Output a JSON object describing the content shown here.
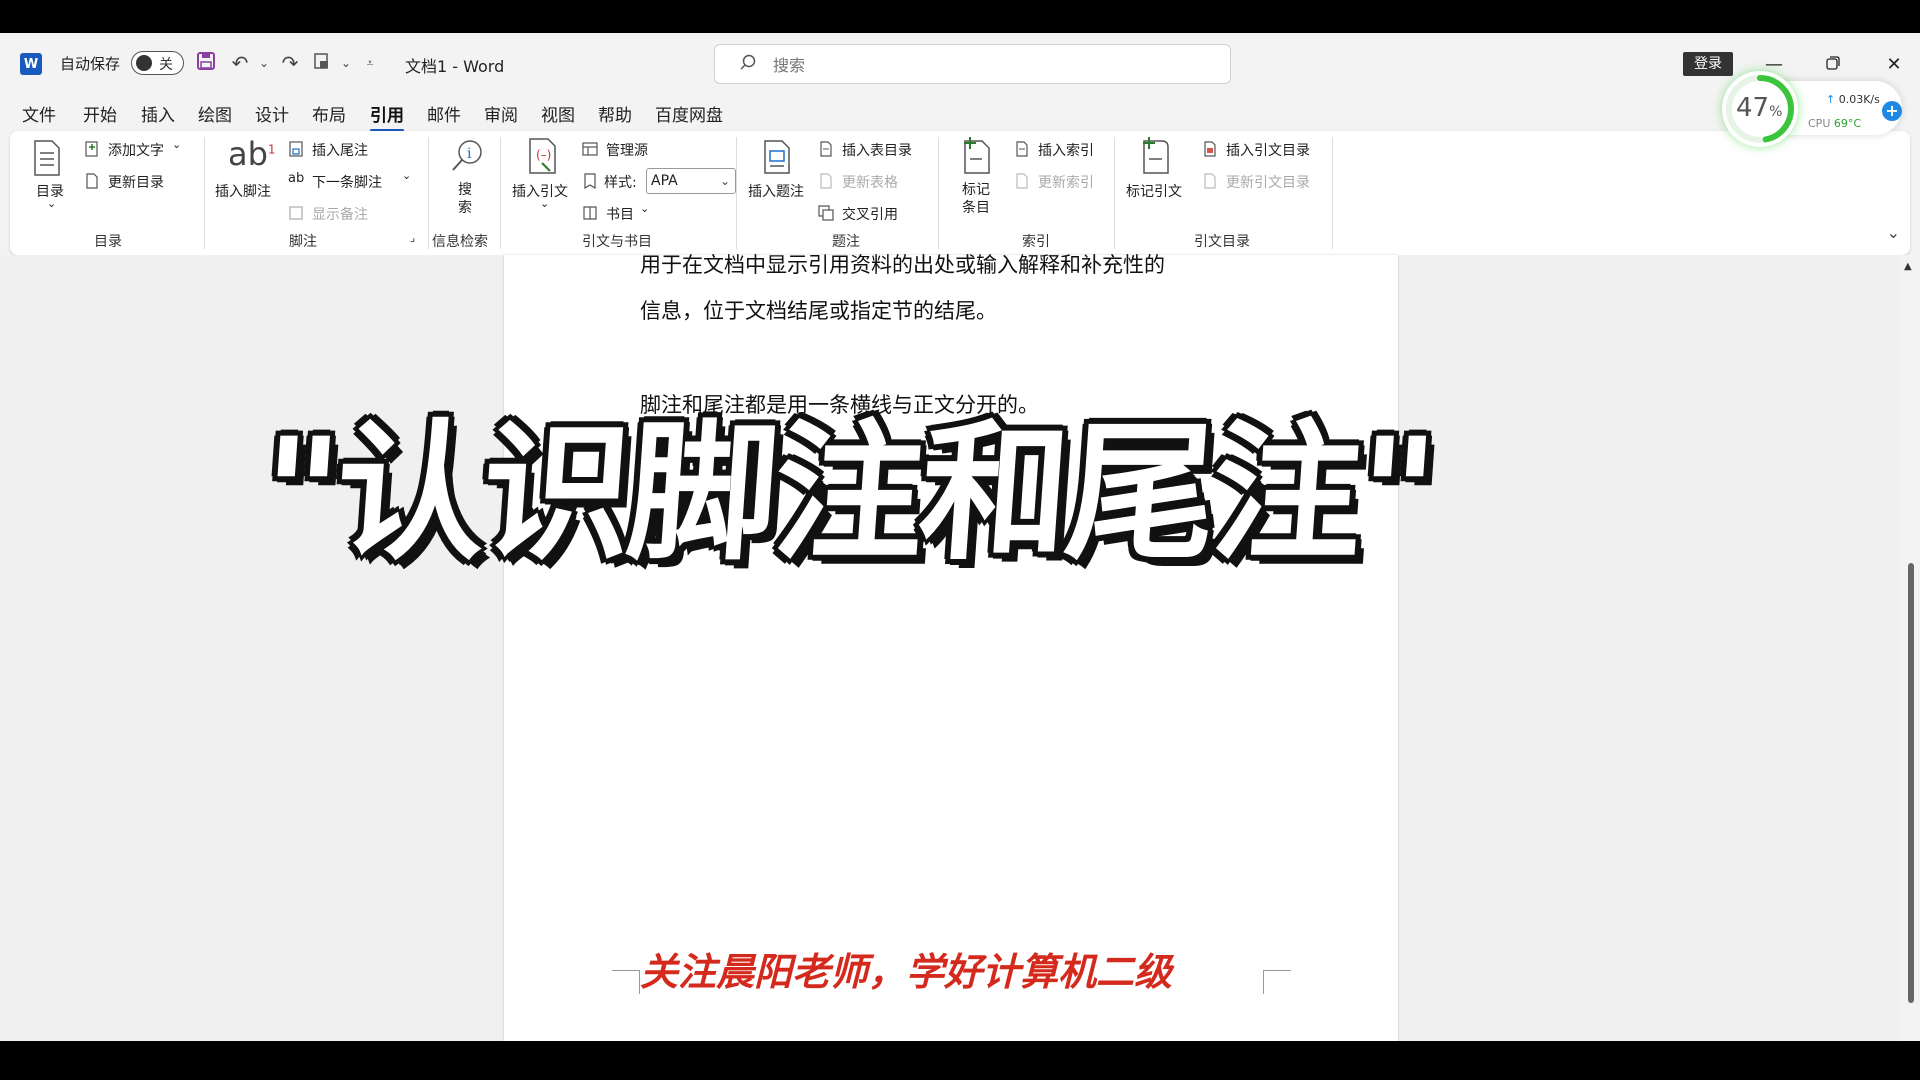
{
  "titlebar": {
    "autosave_label": "自动保存",
    "autosave_state": "关",
    "document_title": "文档1  -  Word",
    "search_placeholder": "搜索",
    "login_label": "登录"
  },
  "tabs": [
    {
      "label": "文件"
    },
    {
      "label": "开始"
    },
    {
      "label": "插入"
    },
    {
      "label": "绘图"
    },
    {
      "label": "设计"
    },
    {
      "label": "布局"
    },
    {
      "label": "引用"
    },
    {
      "label": "邮件"
    },
    {
      "label": "审阅"
    },
    {
      "label": "视图"
    },
    {
      "label": "帮助"
    },
    {
      "label": "百度网盘"
    }
  ],
  "active_tab": "引用",
  "ribbon": {
    "toc": {
      "toc_button": "目录",
      "add_text": "添加文字",
      "update_toc": "更新目录",
      "group_label": "目录"
    },
    "footnotes": {
      "insert_footnote": "插入脚注",
      "insert_endnote": "插入尾注",
      "next_footnote": "下一条脚注",
      "show_notes": "显示备注",
      "group_label": "脚注"
    },
    "research": {
      "search_line1": "搜",
      "search_line2": "索",
      "group_label": "信息检索"
    },
    "citations": {
      "insert_citation": "插入引文",
      "manage_sources": "管理源",
      "style_label": "样式:",
      "style_value": "APA",
      "bibliography": "书目",
      "group_label": "引文与书目"
    },
    "captions": {
      "insert_caption": "插入题注",
      "insert_table_of_figures": "插入表目录",
      "update_table": "更新表格",
      "cross_reference": "交叉引用",
      "group_label": "题注"
    },
    "index": {
      "mark_entry_line1": "标记",
      "mark_entry_line2": "条目",
      "insert_index": "插入索引",
      "update_index": "更新索引",
      "group_label": "索引"
    },
    "table_of_authorities": {
      "mark_citation": "标记引文",
      "insert_toa": "插入引文目录",
      "update_toa": "更新引文目录",
      "group_label": "引文目录"
    }
  },
  "perf_widget": {
    "percent": "47",
    "percent_sign": "%",
    "net_speed": "0.03K/s",
    "cpu_label": "CPU",
    "cpu_temp": "69°C"
  },
  "document": {
    "line1": "用于在文档中显示引用资料的出处或输入解释和补充性的",
    "line2": "信息，位于文档结尾或指定节的结尾。",
    "line3": "脚注和尾注都是用一条横线与正文分开的。",
    "footer": "关注晨阳老师，学好计算机二级"
  },
  "overlay": {
    "caption": "\"认识脚注和尾注\""
  },
  "colors": {
    "accent": "#185abd",
    "footer_red": "#d42a1e",
    "cpu_green": "#2ca02c"
  }
}
